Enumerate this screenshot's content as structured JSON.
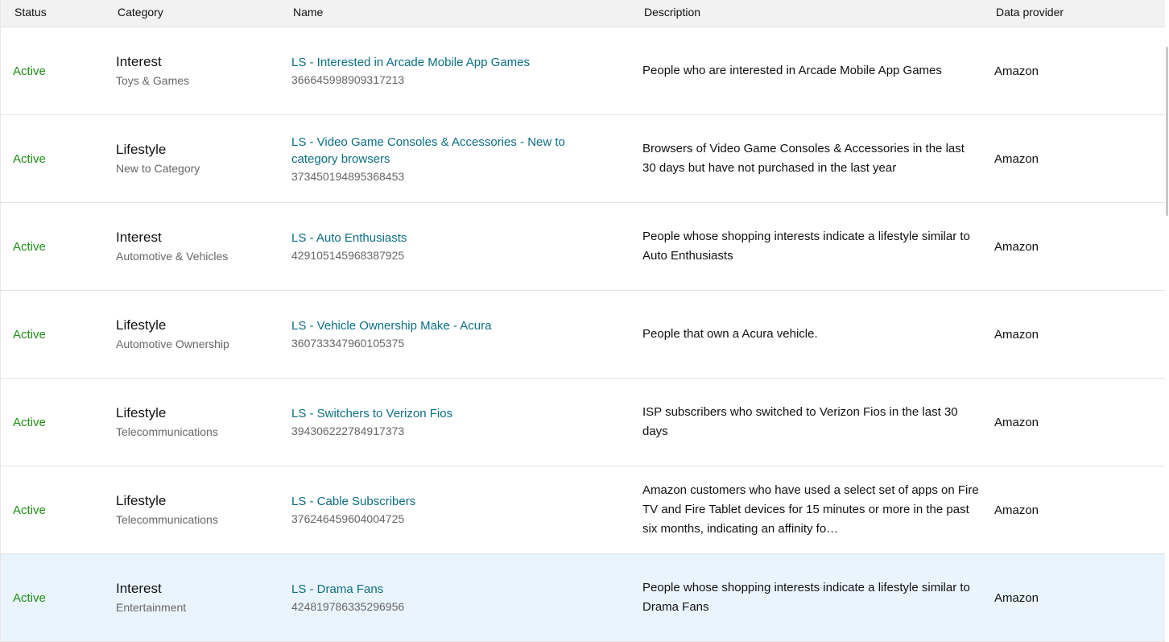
{
  "columns": {
    "status": "Status",
    "category": "Category",
    "name": "Name",
    "description": "Description",
    "provider": "Data provider"
  },
  "rows": [
    {
      "status": "Active",
      "category": "Interest",
      "subcategory": "Toys & Games",
      "name": "LS - Interested in Arcade Mobile App Games",
      "id": "366645998909317213",
      "description": "People who are interested in Arcade Mobile App Games",
      "provider": "Amazon"
    },
    {
      "status": "Active",
      "category": "Lifestyle",
      "subcategory": "New to Category",
      "name": "LS - Video Game Consoles & Accessories - New to category browsers",
      "id": "373450194895368453",
      "description": "Browsers of Video Game Consoles & Accessories in the last 30 days but have not purchased in the last year",
      "provider": "Amazon"
    },
    {
      "status": "Active",
      "category": "Interest",
      "subcategory": "Automotive & Vehicles",
      "name": "LS - Auto Enthusiasts",
      "id": "429105145968387925",
      "description": "People whose shopping interests indicate a lifestyle similar to Auto Enthusiasts",
      "provider": "Amazon"
    },
    {
      "status": "Active",
      "category": "Lifestyle",
      "subcategory": "Automotive Ownership",
      "name": "LS - Vehicle Ownership Make - Acura",
      "id": "360733347960105375",
      "description": "People that own a Acura vehicle.",
      "provider": "Amazon"
    },
    {
      "status": "Active",
      "category": "Lifestyle",
      "subcategory": "Telecommunications",
      "name": "LS - Switchers to Verizon Fios",
      "id": "394306222784917373",
      "description": "ISP subscribers who switched to Verizon Fios in the last 30 days",
      "provider": "Amazon"
    },
    {
      "status": "Active",
      "category": "Lifestyle",
      "subcategory": "Telecommunications",
      "name": "LS - Cable Subscribers",
      "id": "376246459604004725",
      "description": "Amazon customers who have used a select set of apps on Fire TV and Fire Tablet devices for 15 minutes or more in the past six months, indicating an affinity fo…",
      "provider": "Amazon"
    },
    {
      "status": "Active",
      "category": "Interest",
      "subcategory": "Entertainment",
      "name": "LS - Drama Fans",
      "id": "424819786335296956",
      "description": "People whose shopping interests indicate a lifestyle similar to Drama Fans",
      "provider": "Amazon"
    }
  ]
}
